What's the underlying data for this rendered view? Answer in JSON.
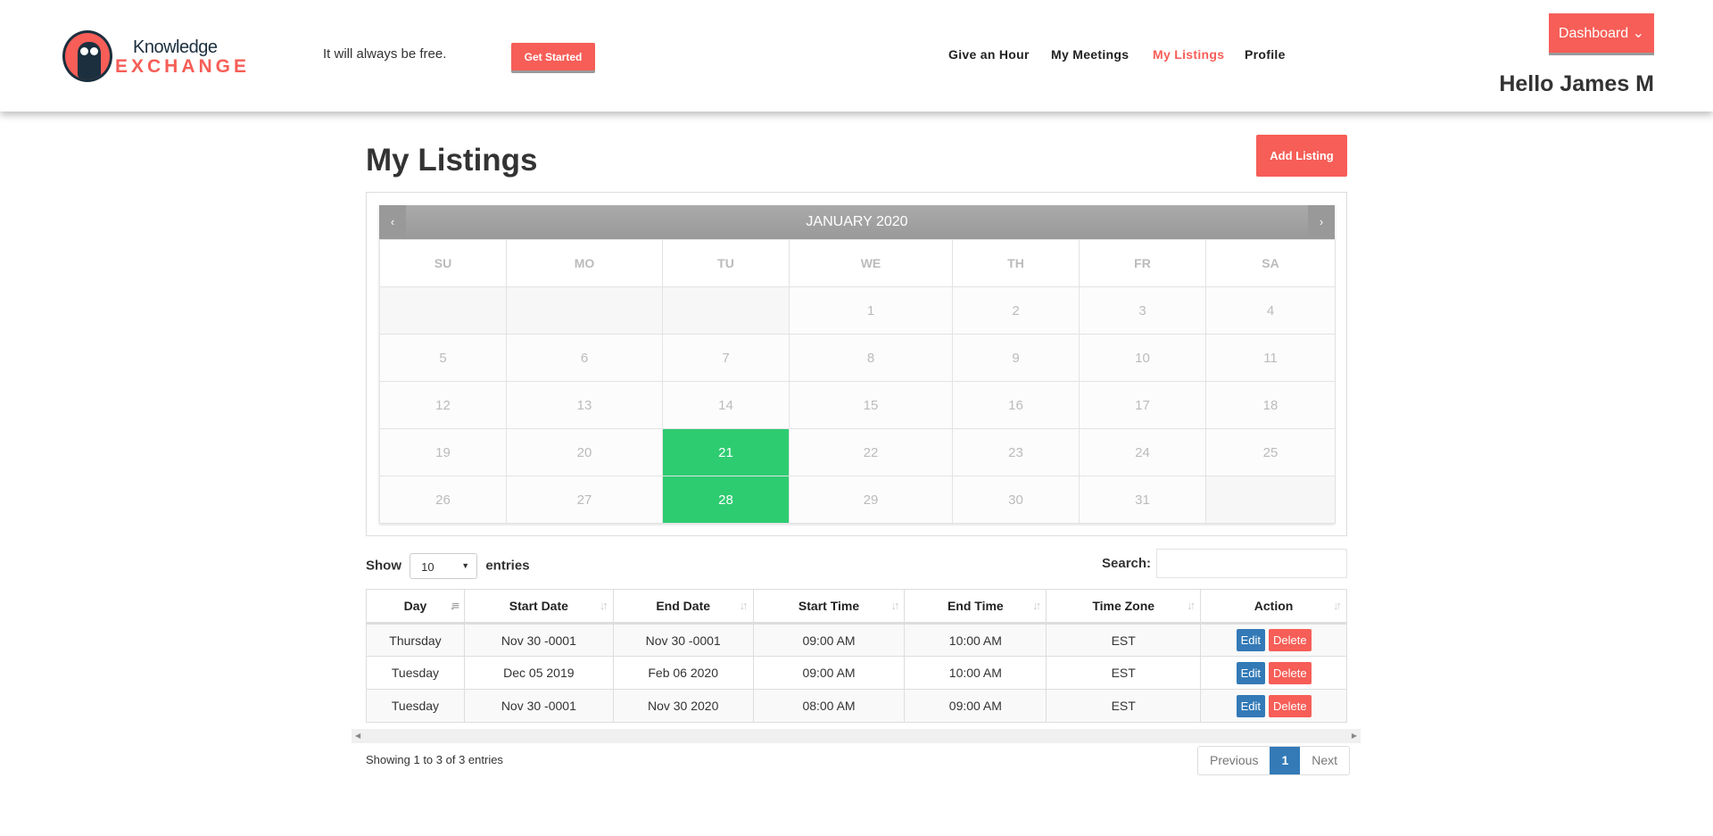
{
  "header": {
    "logo_top": "Knowledge",
    "logo_bottom": "EXCHANGE",
    "tagline": "It will always be free.",
    "get_started": "Get Started",
    "nav": [
      {
        "label": "Give an Hour"
      },
      {
        "label": "My Meetings"
      },
      {
        "label": "My Listings"
      },
      {
        "label": "Profile"
      }
    ],
    "dashboard": "Dashboard",
    "greeting": "Hello James M",
    "active_color": "#f65e57"
  },
  "page": {
    "title": "My Listings",
    "add_listing": "Add Listing"
  },
  "calendar": {
    "month": "JANUARY 2020",
    "prev": "‹",
    "next": "›",
    "weekdays": [
      "SU",
      "MO",
      "TU",
      "WE",
      "TH",
      "FR",
      "SA"
    ],
    "weeks": [
      [
        "",
        "",
        "",
        "1",
        "2",
        "3",
        "4"
      ],
      [
        "5",
        "6",
        "7",
        "8",
        "9",
        "10",
        "11"
      ],
      [
        "12",
        "13",
        "14",
        "15",
        "16",
        "17",
        "18"
      ],
      [
        "19",
        "20",
        "21",
        "22",
        "23",
        "24",
        "25"
      ],
      [
        "26",
        "27",
        "28",
        "29",
        "30",
        "31",
        ""
      ]
    ],
    "highlighted": [
      "21",
      "28"
    ],
    "highlight_color": "#2ecc71"
  },
  "table_controls": {
    "show": "Show",
    "length": "10",
    "entries": "entries",
    "search_label": "Search:",
    "search_value": ""
  },
  "table": {
    "columns": [
      "Day",
      "Start Date",
      "End Date",
      "Start Time",
      "End Time",
      "Time Zone",
      "Action"
    ],
    "rows": [
      [
        "Thursday",
        "Nov 30 -0001",
        "Nov 30 -0001",
        "09:00 AM",
        "10:00 AM",
        "EST"
      ],
      [
        "Tuesday",
        "Dec 05 2019",
        "Feb 06 2020",
        "09:00 AM",
        "10:00 AM",
        "EST"
      ],
      [
        "Tuesday",
        "Nov 30 -0001",
        "Nov 30 2020",
        "08:00 AM",
        "09:00 AM",
        "EST"
      ]
    ],
    "edit": "Edit",
    "delete": "Delete"
  },
  "footer": {
    "info": "Showing 1 to 3 of 3 entries",
    "previous": "Previous",
    "page": "1",
    "next": "Next"
  }
}
